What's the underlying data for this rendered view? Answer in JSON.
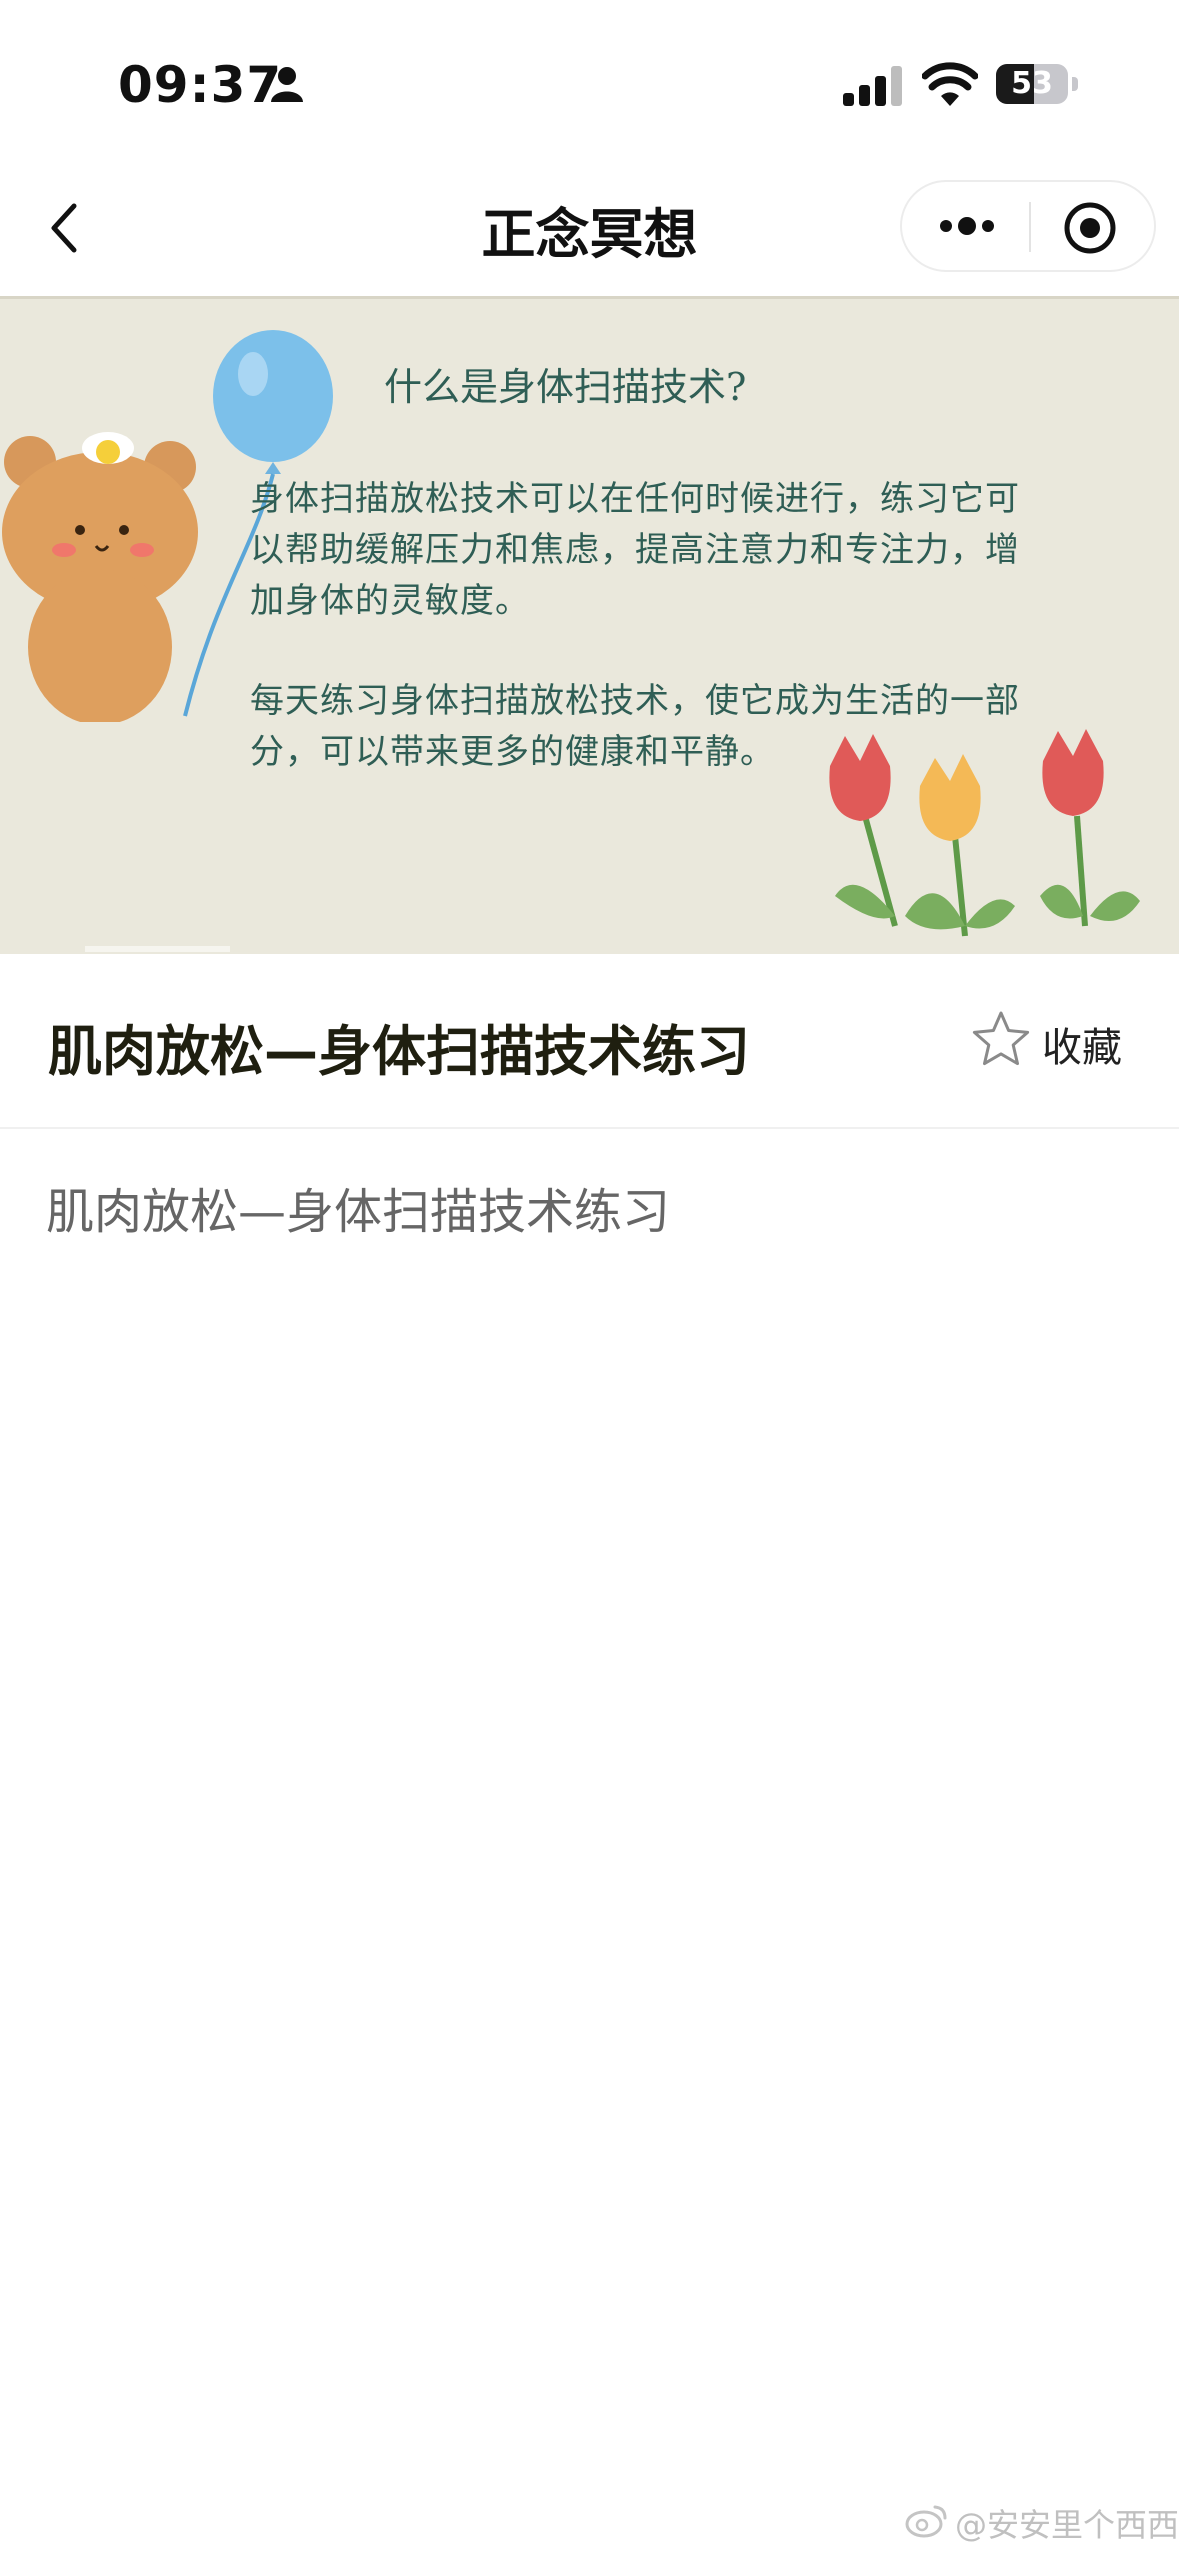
{
  "status_bar": {
    "time": "09:37",
    "battery": "53",
    "battery_level": 0.53
  },
  "nav": {
    "title": "正念冥想"
  },
  "banner": {
    "heading": "什么是身体扫描技术?",
    "paragraph1": "身体扫描放松技术可以在任何时候进行，练习它可以帮助缓解压力和焦虑，提高注意力和专注力，增加身体的灵敏度。",
    "paragraph2": "每天练习身体扫描放松技术，使它成为生活的一部分，可以带来更多的健康和平静。"
  },
  "article": {
    "title": "肌肉放松—身体扫描技术练习",
    "favorite_label": "收藏",
    "content": "肌肉放松—身体扫描技术练习"
  },
  "watermark": {
    "text": "@安安里个西西"
  },
  "colors": {
    "banner_bg": "#eae8dc",
    "banner_text": "#2f5e55",
    "title": "#1f1f10"
  },
  "icons": [
    "person-icon",
    "signal-icon",
    "wifi-icon",
    "battery-icon",
    "back-icon",
    "more-icon",
    "target-icon",
    "star-icon",
    "weibo-icon"
  ]
}
